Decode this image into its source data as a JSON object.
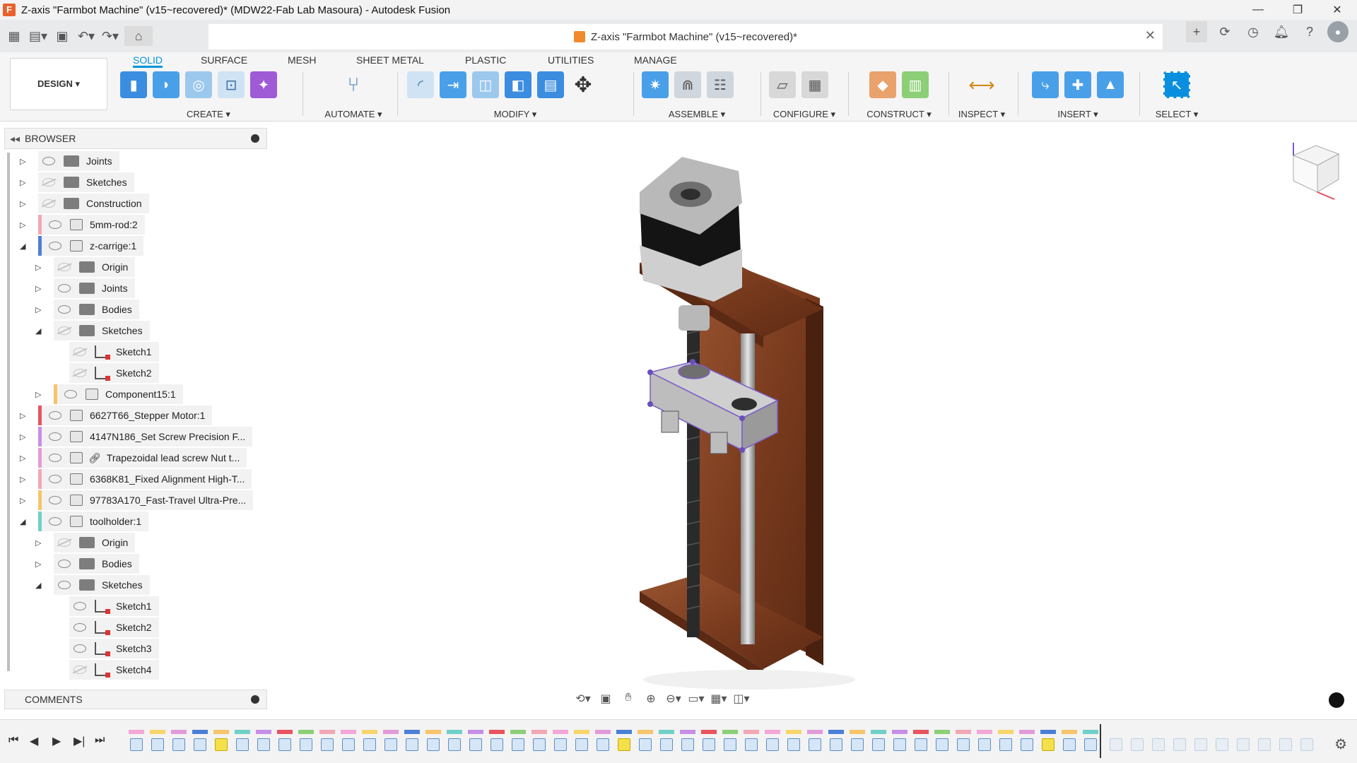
{
  "window": {
    "title": "Z-axis \"Farmbot Machine\" (v15~recovered)* (MDW22-Fab Lab Masoura) - Autodesk Fusion",
    "app_icon": "F"
  },
  "doc": {
    "tab_title": "Z-axis \"Farmbot Machine\" (v15~recovered)*"
  },
  "ribbon": {
    "workspace": "DESIGN ▾",
    "tabs": [
      "SOLID",
      "SURFACE",
      "MESH",
      "SHEET METAL",
      "PLASTIC",
      "UTILITIES",
      "MANAGE"
    ],
    "groups": [
      "CREATE ▾",
      "AUTOMATE ▾",
      "MODIFY ▾",
      "ASSEMBLE ▾",
      "CONFIGURE ▾",
      "CONSTRUCT ▾",
      "INSPECT ▾",
      "INSERT ▾",
      "SELECT ▾"
    ]
  },
  "browser": {
    "title": "BROWSER",
    "items": [
      {
        "label": "Joints",
        "level": 1,
        "expanded": false,
        "icon": "folder",
        "visible": true,
        "color": ""
      },
      {
        "label": "Sketches",
        "level": 1,
        "expanded": false,
        "icon": "folder",
        "visible": false,
        "color": ""
      },
      {
        "label": "Construction",
        "level": 1,
        "expanded": false,
        "icon": "folder",
        "visible": false,
        "color": ""
      },
      {
        "label": "5mm-rod:2",
        "level": 1,
        "expanded": false,
        "icon": "component",
        "visible": true,
        "color": "#f2a7b5"
      },
      {
        "label": "z-carrige:1",
        "level": 1,
        "expanded": true,
        "icon": "component",
        "visible": true,
        "color": "#4a7fd6"
      },
      {
        "label": "Origin",
        "level": 2,
        "expanded": false,
        "icon": "folder",
        "visible": false,
        "color": ""
      },
      {
        "label": "Joints",
        "level": 2,
        "expanded": false,
        "icon": "folder",
        "visible": true,
        "color": ""
      },
      {
        "label": "Bodies",
        "level": 2,
        "expanded": false,
        "icon": "folder",
        "visible": true,
        "color": ""
      },
      {
        "label": "Sketches",
        "level": 2,
        "expanded": true,
        "icon": "folder",
        "visible": false,
        "color": ""
      },
      {
        "label": "Sketch1",
        "level": 3,
        "expanded": null,
        "icon": "sketch",
        "visible": false,
        "color": ""
      },
      {
        "label": "Sketch2",
        "level": 3,
        "expanded": null,
        "icon": "sketch",
        "visible": false,
        "color": ""
      },
      {
        "label": "Component15:1",
        "level": 2,
        "expanded": false,
        "icon": "component",
        "visible": true,
        "color": "#f6c46a"
      },
      {
        "label": "6627T66_Stepper Motor:1",
        "level": 1,
        "expanded": false,
        "icon": "component",
        "visible": true,
        "color": "#e8545f"
      },
      {
        "label": "4147N186_Set Screw Precision F...",
        "level": 1,
        "expanded": false,
        "icon": "component",
        "visible": true,
        "color": "#c78ee8"
      },
      {
        "label": "Trapezoidal lead screw Nut t...",
        "level": 1,
        "expanded": false,
        "icon": "component-link",
        "visible": true,
        "color": "#e29bd8"
      },
      {
        "label": "6368K81_Fixed Alignment High-T...",
        "level": 1,
        "expanded": false,
        "icon": "component",
        "visible": true,
        "color": "#f2a7b5"
      },
      {
        "label": "97783A170_Fast-Travel Ultra-Pre...",
        "level": 1,
        "expanded": false,
        "icon": "component",
        "visible": true,
        "color": "#f6c46a"
      },
      {
        "label": "toolholder:1",
        "level": 1,
        "expanded": true,
        "icon": "component",
        "visible": true,
        "color": "#6fd0c8"
      },
      {
        "label": "Origin",
        "level": 2,
        "expanded": false,
        "icon": "folder",
        "visible": false,
        "color": ""
      },
      {
        "label": "Bodies",
        "level": 2,
        "expanded": false,
        "icon": "folder",
        "visible": true,
        "color": ""
      },
      {
        "label": "Sketches",
        "level": 2,
        "expanded": true,
        "icon": "folder",
        "visible": true,
        "color": ""
      },
      {
        "label": "Sketch1",
        "level": 3,
        "expanded": null,
        "icon": "sketch",
        "visible": true,
        "color": ""
      },
      {
        "label": "Sketch2",
        "level": 3,
        "expanded": null,
        "icon": "sketch",
        "visible": true,
        "color": ""
      },
      {
        "label": "Sketch3",
        "level": 3,
        "expanded": null,
        "icon": "sketch",
        "visible": true,
        "color": ""
      },
      {
        "label": "Sketch4",
        "level": 3,
        "expanded": null,
        "icon": "sketch",
        "visible": false,
        "color": ""
      }
    ]
  },
  "comments": {
    "title": "COMMENTS"
  },
  "colors": {
    "accent": "#0696d7",
    "wood": "#8a4a2a",
    "motor": "#1a1a1a"
  }
}
